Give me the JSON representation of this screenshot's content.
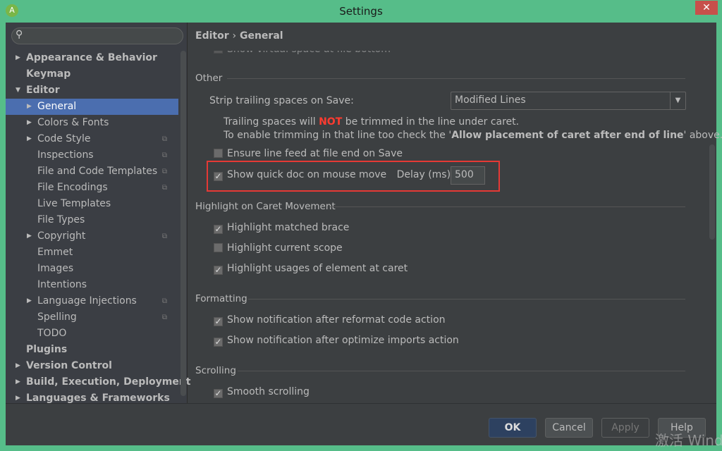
{
  "window": {
    "title": "Settings",
    "close_icon": "close-icon",
    "app_icon": "android-studio-icon"
  },
  "search": {
    "placeholder": "",
    "value": ""
  },
  "tree": [
    {
      "label": "Appearance & Behavior",
      "level": 0,
      "bold": true,
      "arrow": "right"
    },
    {
      "label": "Keymap",
      "level": 0,
      "bold": true
    },
    {
      "label": "Editor",
      "level": 0,
      "bold": true,
      "arrow": "down"
    },
    {
      "label": "General",
      "level": 1,
      "arrow": "right",
      "selected": true
    },
    {
      "label": "Colors & Fonts",
      "level": 1,
      "arrow": "right"
    },
    {
      "label": "Code Style",
      "level": 1,
      "arrow": "right",
      "cfg": true
    },
    {
      "label": "Inspections",
      "level": 1,
      "cfg": true
    },
    {
      "label": "File and Code Templates",
      "level": 1,
      "cfg": true
    },
    {
      "label": "File Encodings",
      "level": 1,
      "cfg": true
    },
    {
      "label": "Live Templates",
      "level": 1
    },
    {
      "label": "File Types",
      "level": 1
    },
    {
      "label": "Copyright",
      "level": 1,
      "arrow": "right",
      "cfg": true
    },
    {
      "label": "Emmet",
      "level": 1
    },
    {
      "label": "Images",
      "level": 1
    },
    {
      "label": "Intentions",
      "level": 1
    },
    {
      "label": "Language Injections",
      "level": 1,
      "arrow": "right",
      "cfg": true
    },
    {
      "label": "Spelling",
      "level": 1,
      "cfg": true
    },
    {
      "label": "TODO",
      "level": 1
    },
    {
      "label": "Plugins",
      "level": 0,
      "bold": true
    },
    {
      "label": "Version Control",
      "level": 0,
      "bold": true,
      "arrow": "right"
    },
    {
      "label": "Build, Execution, Deployment",
      "level": 0,
      "bold": true,
      "arrow": "right"
    },
    {
      "label": "Languages & Frameworks",
      "level": 0,
      "bold": true,
      "arrow": "right"
    }
  ],
  "breadcrumb": {
    "parent": "Editor",
    "sep": "›",
    "current": "General"
  },
  "main": {
    "cut_option": "Show virtual space at file bottom",
    "other": {
      "title": "Other",
      "strip_label": "Strip trailing spaces on Save:",
      "strip_value": "Modified Lines",
      "note1_a": "Trailing spaces will ",
      "note1_not": "NOT",
      "note1_b": " be trimmed in the line under caret.",
      "note2_a": "To enable trimming in that line too check the '",
      "note2_bold": "Allow placement of caret after end of line",
      "note2_b": "' above.",
      "line_feed": {
        "label": "Ensure line feed at file end on Save",
        "checked": false
      },
      "quick_doc": {
        "label": "Show quick doc on mouse move",
        "checked": true,
        "delay_label": "Delay (ms):",
        "delay_value": "500"
      }
    },
    "highlight": {
      "title": "Highlight on Caret Movement",
      "items": [
        {
          "label": "Highlight matched brace",
          "checked": true
        },
        {
          "label": "Highlight current scope",
          "checked": false
        },
        {
          "label": "Highlight usages of element at caret",
          "checked": true
        }
      ]
    },
    "formatting": {
      "title": "Formatting",
      "items": [
        {
          "label": "Show notification after reformat code action",
          "checked": true
        },
        {
          "label": "Show notification after optimize imports action",
          "checked": true
        }
      ]
    },
    "scrolling": {
      "title": "Scrolling",
      "items": [
        {
          "label": "Smooth scrolling",
          "checked": true
        }
      ]
    }
  },
  "buttons": {
    "ok": "OK",
    "cancel": "Cancel",
    "apply": "Apply",
    "help": "Help"
  },
  "watermark": "激活 Wind",
  "colors": {
    "selection": "#4b6eaf",
    "highlight_box": "#e53935",
    "not_text": "#ff3b30",
    "title_bar": "#56bd89"
  }
}
